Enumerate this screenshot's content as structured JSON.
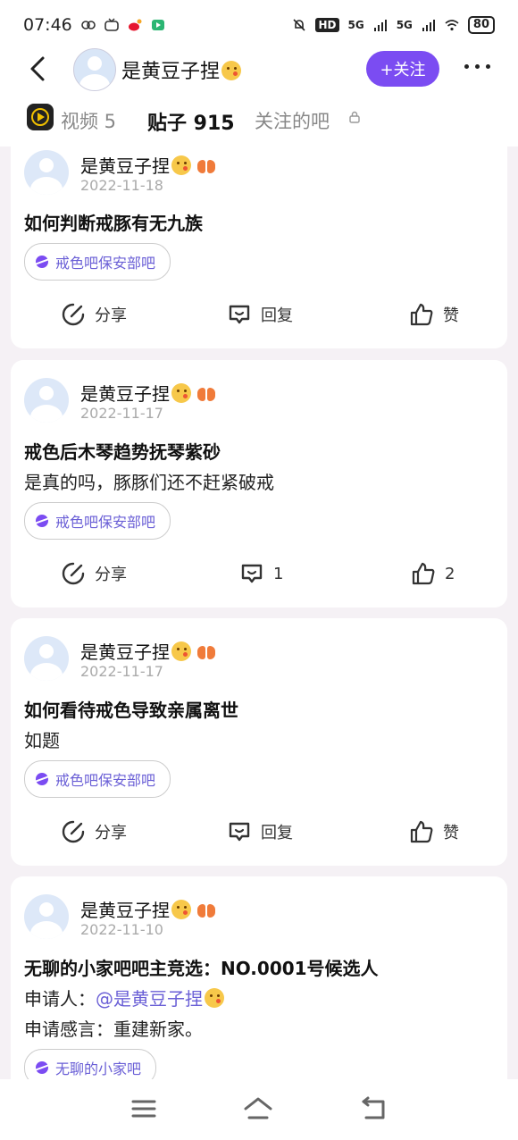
{
  "status_bar": {
    "time": "07:46",
    "network_1": "5G",
    "network_2": "5G",
    "battery": "80",
    "hd_label": "HD"
  },
  "header": {
    "username": "是黄豆子捏",
    "follow_label": "+关注"
  },
  "tabs": [
    {
      "label": "视频 5"
    },
    {
      "label": "贴子 915"
    },
    {
      "label": "关注的吧"
    }
  ],
  "posts": [
    {
      "author": "是黄豆子捏",
      "date": "2022-11-18",
      "title": "如何判断戒豚有无九族",
      "body": [],
      "forum": "戒色吧保安部吧",
      "share": "分享",
      "reply": "回复",
      "like": "赞"
    },
    {
      "author": "是黄豆子捏",
      "date": "2022-11-17",
      "title": "戒色后木琴趋势抚琴紫砂",
      "body": [
        "是真的吗，豚豚们还不赶紧破戒"
      ],
      "forum": "戒色吧保安部吧",
      "share": "分享",
      "reply": "1",
      "like": "2"
    },
    {
      "author": "是黄豆子捏",
      "date": "2022-11-17",
      "title": "如何看待戒色导致亲属离世",
      "body": [
        "如题"
      ],
      "forum": "戒色吧保安部吧",
      "share": "分享",
      "reply": "回复",
      "like": "赞"
    },
    {
      "author": "是黄豆子捏",
      "date": "2022-11-10",
      "title": "无聊的小家吧吧主竞选：NO.0001号候选人",
      "applicant_label": "申请人：",
      "applicant_mention": "@是黄豆子捏",
      "statement": "申请感言：重建新家。",
      "forum": "无聊的小家吧"
    }
  ],
  "colors": {
    "accent": "#7b4cf2",
    "mention": "#6a5fd6",
    "page_bg": "#f5f1f5"
  }
}
